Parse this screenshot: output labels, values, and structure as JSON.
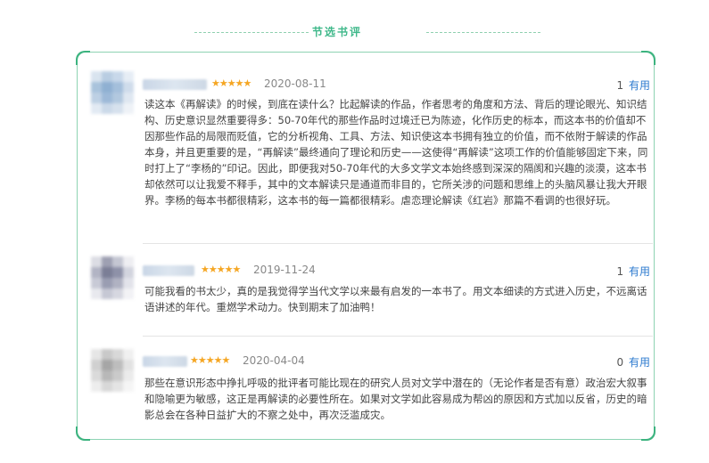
{
  "header": {
    "title": "节选书评"
  },
  "colors": {
    "accent": "#3cb37f",
    "link": "#2e7bcf",
    "star": "#f5a623"
  },
  "reviews": [
    {
      "stars": "★★★★★",
      "rating": 5,
      "date": "2020-08-11",
      "useful_count": "1",
      "useful_label": "有用",
      "text": "读这本《再解读》的时候，到底在读什么？比起解读的作品，作者思考的角度和方法、背后的理论眼光、知识结构、历史意识显然重要得多：50-70年代的那些作品时过境迁已为陈迹，化作历史的标本，而这本书的价值却不因那些作品的局限而贬值，它的分析视角、工具、方法、知识使这本书拥有独立的价值，而不依附于解读的作品本身，并且更重要的是，“再解读”最终通向了理论和历史——这使得“再解读”这项工作的价值能够固定下来，同时打上了“李杨的”印记。因此，即便我对50-70年代的大多文学文本始终感到深深的隔阂和兴趣的淡漠，这本书却依然可以让我爱不释手，其中的文本解读只是通道而非目的，它所关涉的问题和思维上的头脑风暴让我大开眼界。李杨的每本书都很精彩，这本书的每一篇都很精彩。虐恋理论解读《红岩》那篇不看调的也很好玩。"
    },
    {
      "stars": "★★★★★",
      "rating": 5,
      "date": "2019-11-24",
      "useful_count": "1",
      "useful_label": "有用",
      "text": "可能我看的书太少，真的是我觉得学当代文学以来最有启发的一本书了。用文本细读的方式进入历史，不远离话语讲述的年代。重燃学术动力。快到期末了加油鸭！"
    },
    {
      "stars": "★★★★★",
      "rating": 5,
      "date": "2020-04-04",
      "useful_count": "0",
      "useful_label": "有用",
      "text": "那些在意识形态中挣扎呼吸的批评者可能比现在的研究人员对文学中潜在的（无论作者是否有意）政治宏大叙事和隐喻更为敏感，这正是再解读的必要性所在。如果对文学如此容易成为帮凶的原因和方式加以反省，历史的暗影总会在各种日益扩大的不察之处中，再次泛滥成灾。"
    }
  ]
}
